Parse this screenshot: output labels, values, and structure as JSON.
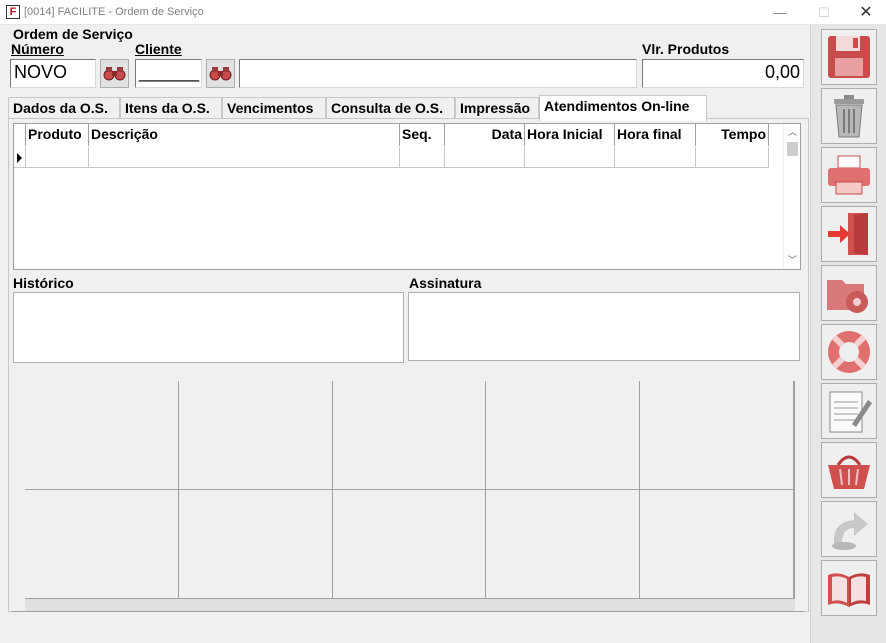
{
  "window": {
    "app_icon_letter": "F",
    "title": "[0014] FACILITE - Ordem de Serviço",
    "minimize_glyph": "—",
    "maximize_glyph": "☐",
    "close_glyph": "✕"
  },
  "header": {
    "section_title": "Ordem de Serviço",
    "numero_label": "Número",
    "numero_value": "NOVO",
    "cliente_label": "Cliente",
    "cliente_code_value": "______",
    "cliente_name_value": "",
    "vlr_produtos_label": "Vlr. Produtos",
    "vlr_produtos_value": "0,00"
  },
  "tabs": [
    {
      "label": "Dados da O.S."
    },
    {
      "label": "Itens da O.S."
    },
    {
      "label": "Vencimentos"
    },
    {
      "label": "Consulta de O.S."
    },
    {
      "label": "Impressão"
    },
    {
      "label": "Atendimentos On-line"
    }
  ],
  "active_tab": "Atendimentos On-line",
  "grid": {
    "columns": [
      "Produto",
      "Descrição",
      "Seq.",
      "Data",
      "Hora Inicial",
      "Hora final",
      "Tempo"
    ],
    "rows": [
      [
        "",
        "",
        "",
        "",
        "",
        "",
        ""
      ]
    ]
  },
  "historico": {
    "label": "Histórico",
    "value": ""
  },
  "assinatura": {
    "label": "Assinatura"
  },
  "toolbar": [
    {
      "icon": "floppy-disk-icon",
      "action": "save"
    },
    {
      "icon": "trash-can-icon",
      "action": "delete"
    },
    {
      "icon": "printer-icon",
      "action": "print"
    },
    {
      "icon": "exit-door-icon",
      "action": "exit"
    },
    {
      "icon": "folder-gear-icon",
      "action": "settings"
    },
    {
      "icon": "lifebuoy-icon",
      "action": "help"
    },
    {
      "icon": "notepad-pencil-icon",
      "action": "notes"
    },
    {
      "icon": "shopping-basket-icon",
      "action": "basket"
    },
    {
      "icon": "refresh-arrow-icon",
      "action": "refresh"
    },
    {
      "icon": "open-book-icon",
      "action": "manual"
    }
  ],
  "colors": {
    "icon_red": "#c84c4c",
    "icon_gray": "#9a9a9a"
  }
}
